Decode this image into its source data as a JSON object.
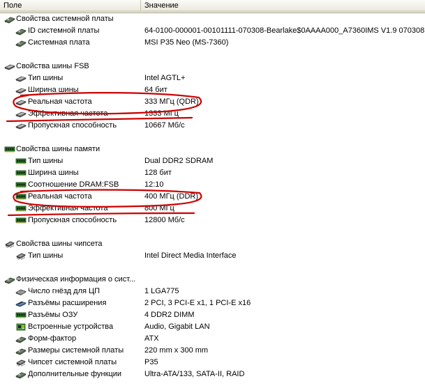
{
  "header": {
    "col_field": "Поле",
    "col_value": "Значение"
  },
  "rows": [
    {
      "t": "g",
      "icon": "motherboard-icon",
      "label": "Свойства системной платы",
      "value": ""
    },
    {
      "t": "c",
      "icon": "motherboard-icon",
      "label": "ID системной платы",
      "value": "64-0100-000001-00101111-070308-Bearlake$0AAAA000_A7360IMS V1.9 070308"
    },
    {
      "t": "c",
      "icon": "motherboard-icon",
      "label": "Системная плата",
      "value": "MSI P35 Neo (MS-7360)"
    },
    {
      "t": "b"
    },
    {
      "t": "g",
      "icon": "bus-icon",
      "label": "Свойства шины FSB",
      "value": ""
    },
    {
      "t": "c",
      "icon": "bus-icon",
      "label": "Тип шины",
      "value": "Intel AGTL+"
    },
    {
      "t": "c",
      "icon": "bus-icon",
      "label": "Ширина шины",
      "value": "64 бит"
    },
    {
      "t": "c",
      "icon": "bus-icon",
      "label": "Реальная частота",
      "value": "333 МГц (QDR)"
    },
    {
      "t": "c",
      "icon": "bus-icon",
      "label": "Эффективная частота",
      "value": "1333 МГц"
    },
    {
      "t": "c",
      "icon": "bus-icon",
      "label": "Пропускная способность",
      "value": "10667 Мб/с"
    },
    {
      "t": "b"
    },
    {
      "t": "g",
      "icon": "memory-icon",
      "label": "Свойства шины памяти",
      "value": ""
    },
    {
      "t": "c",
      "icon": "memory-icon",
      "label": "Тип шины",
      "value": "Dual DDR2 SDRAM"
    },
    {
      "t": "c",
      "icon": "memory-icon",
      "label": "Ширина шины",
      "value": "128 бит"
    },
    {
      "t": "c",
      "icon": "memory-icon",
      "label": "Соотношение DRAM:FSB",
      "value": "12:10"
    },
    {
      "t": "c",
      "icon": "memory-icon",
      "label": "Реальная частота",
      "value": "400 МГц (DDR)"
    },
    {
      "t": "c",
      "icon": "memory-icon",
      "label": "Эффективная частота",
      "value": "800 МГц"
    },
    {
      "t": "c",
      "icon": "memory-icon",
      "label": "Пропускная способность",
      "value": "12800 Мб/с"
    },
    {
      "t": "b"
    },
    {
      "t": "g",
      "icon": "chipset-icon",
      "label": "Свойства шины чипсета",
      "value": ""
    },
    {
      "t": "c",
      "icon": "chipset-icon",
      "label": "Тип шины",
      "value": "Intel Direct Media Interface"
    },
    {
      "t": "b"
    },
    {
      "t": "g",
      "icon": "motherboard-icon",
      "label": "Физическая информация о сист...",
      "value": ""
    },
    {
      "t": "c",
      "icon": "cpu-socket-icon",
      "label": "Число гнёзд для ЦП",
      "value": "1 LGA775"
    },
    {
      "t": "c",
      "icon": "expansion-slot-icon",
      "label": "Разъёмы расширения",
      "value": "2 PCI, 3 PCI-E x1, 1 PCI-E x16"
    },
    {
      "t": "c",
      "icon": "memory-icon",
      "label": "Разъёмы ОЗУ",
      "value": "4 DDR2 DIMM"
    },
    {
      "t": "c",
      "icon": "integrated-device-icon",
      "label": "Встроенные устройства",
      "value": "Audio, Gigabit LAN"
    },
    {
      "t": "c",
      "icon": "motherboard-icon",
      "label": "Форм-фактор",
      "value": "ATX"
    },
    {
      "t": "c",
      "icon": "motherboard-icon",
      "label": "Размеры системной платы",
      "value": "220 mm x 300 mm"
    },
    {
      "t": "c",
      "icon": "chipset-icon",
      "label": "Чипсет системной платы",
      "value": "P35"
    },
    {
      "t": "c",
      "icon": "motherboard-icon",
      "label": "Дополнительные функции",
      "value": "Ultra-ATA/133, SATA-II, RAID"
    }
  ]
}
